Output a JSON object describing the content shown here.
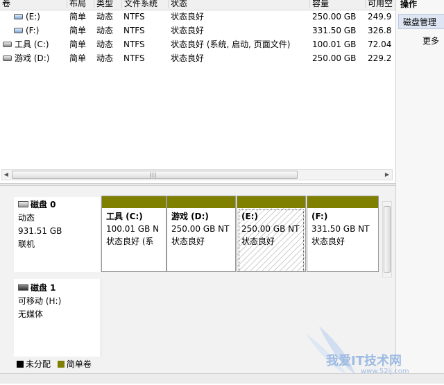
{
  "volume_list": {
    "columns": [
      "卷",
      "布局",
      "类型",
      "文件系统",
      "状态",
      "容量",
      "可用空"
    ],
    "rows": [
      {
        "volume": "(E:)",
        "layout": "简单",
        "type": "动态",
        "fs": "NTFS",
        "status": "状态良好",
        "capacity": "250.00 GB",
        "free": "249.9",
        "icon": "drive-icon"
      },
      {
        "volume": "(F:)",
        "layout": "简单",
        "type": "动态",
        "fs": "NTFS",
        "status": "状态良好",
        "capacity": "331.50 GB",
        "free": "326.8",
        "icon": "drive-icon"
      },
      {
        "volume": "工具 (C:)",
        "layout": "简单",
        "type": "动态",
        "fs": "NTFS",
        "status": "状态良好 (系统, 启动, 页面文件)",
        "capacity": "100.01 GB",
        "free": "72.04",
        "icon": "system-drive-icon"
      },
      {
        "volume": "游戏 (D:)",
        "layout": "简单",
        "type": "动态",
        "fs": "NTFS",
        "status": "状态良好",
        "capacity": "250.00 GB",
        "free": "229.2",
        "icon": "system-drive-icon"
      }
    ],
    "scroll_grip": "|||"
  },
  "disks": [
    {
      "name": "磁盘 0",
      "type": "动态",
      "size": "931.51 GB",
      "state": "联机"
    },
    {
      "name": "磁盘 1",
      "type": "可移动 (H:)",
      "size": "",
      "state": "无媒体"
    }
  ],
  "partitions": [
    {
      "label": "工具  (C:)",
      "size": "100.01 GB N",
      "status": "状态良好 (系"
    },
    {
      "label": "游戏  (D:)",
      "size": "250.00 GB NT",
      "status": "状态良好"
    },
    {
      "label": "(E:)",
      "size": "250.00 GB NT",
      "status": "状态良好"
    },
    {
      "label": "(F:)",
      "size": "331.50 GB NT",
      "status": "状态良好"
    }
  ],
  "legend": [
    {
      "label": "未分配",
      "color": "#000000"
    },
    {
      "label": "简单卷",
      "color": "#808000"
    }
  ],
  "actions": {
    "title": "操作",
    "section": "磁盘管理",
    "more": "更多"
  },
  "colors": {
    "simple_volume": "#808000",
    "unallocated": "#000000",
    "selected_section": "#dde6f2"
  },
  "watermark": {
    "text": "我爱IT技术网",
    "url": "www.52ij.com"
  }
}
